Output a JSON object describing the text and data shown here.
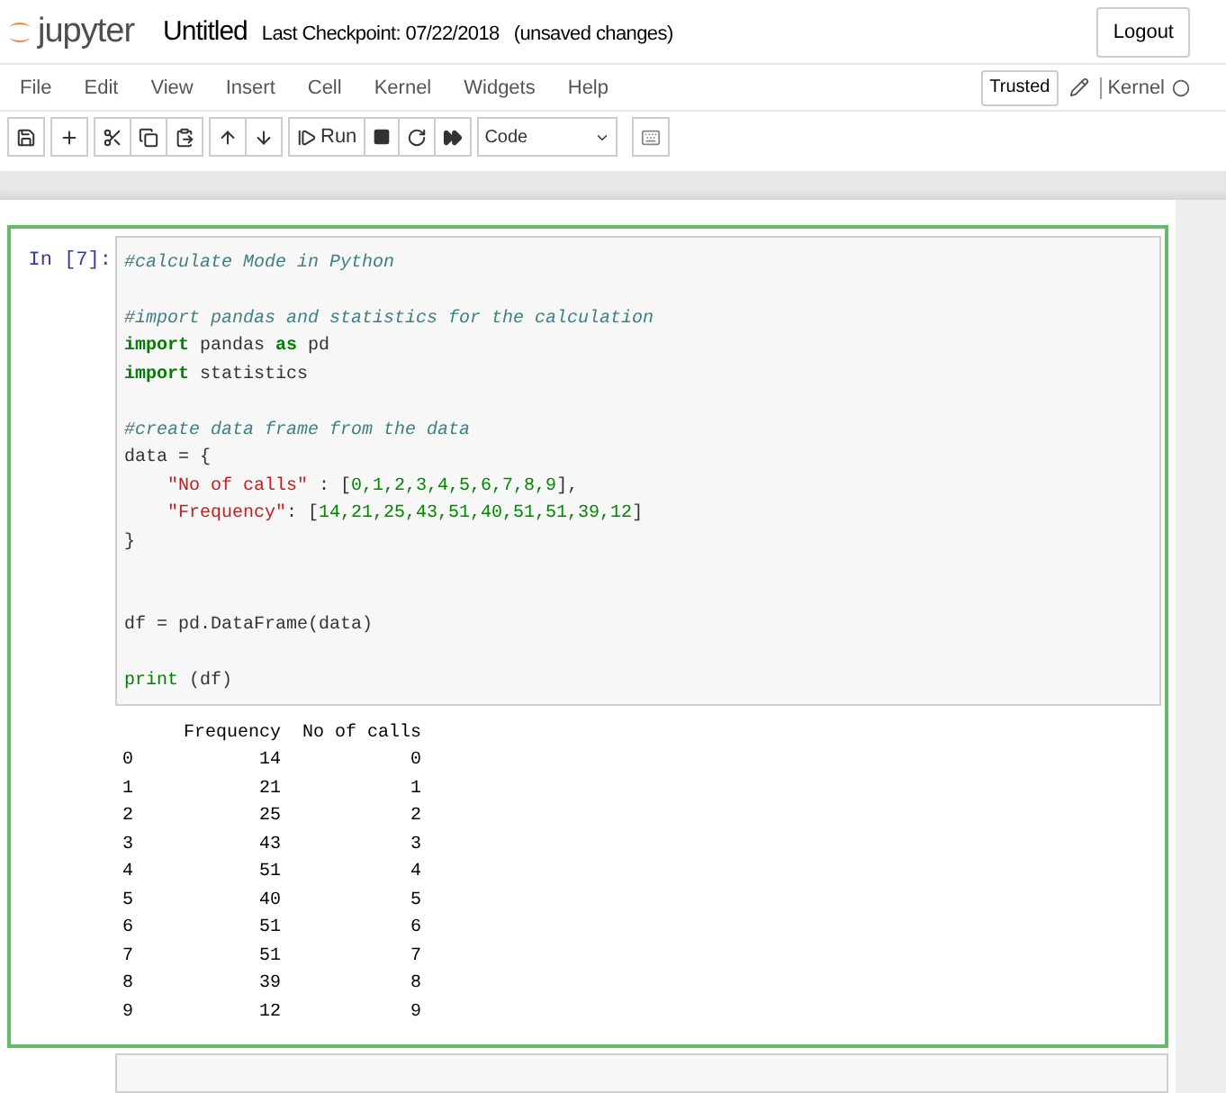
{
  "header": {
    "logo_text": "jupyter",
    "notebook_name": "Untitled",
    "checkpoint": "Last Checkpoint: 07/22/2018",
    "autosave_status": "(unsaved changes)",
    "logout_button": "Logout"
  },
  "menubar": {
    "items": [
      "File",
      "Edit",
      "View",
      "Insert",
      "Cell",
      "Kernel",
      "Widgets",
      "Help"
    ],
    "trusted_button": "Trusted",
    "kernel_label": "Kernel",
    "kernel_busy": false
  },
  "toolbar": {
    "run_label": "Run",
    "cell_type": "Code"
  },
  "cell": {
    "prompt": "In [7]:",
    "selected": true,
    "code_lines": [
      {
        "kind": "code",
        "tokens": [
          {
            "kind": "comment",
            "text": "#calculate Mode in Python"
          }
        ]
      },
      {
        "kind": "blank"
      },
      {
        "kind": "code",
        "tokens": [
          {
            "kind": "comment",
            "text": "#import pandas and statistics for the calculation"
          }
        ]
      },
      {
        "kind": "code",
        "tokens": [
          {
            "kind": "keyword",
            "text": "import"
          },
          {
            "kind": "plain",
            "text": " pandas "
          },
          {
            "kind": "keyword",
            "text": "as"
          },
          {
            "kind": "plain",
            "text": " pd"
          }
        ]
      },
      {
        "kind": "code",
        "tokens": [
          {
            "kind": "keyword",
            "text": "import"
          },
          {
            "kind": "plain",
            "text": " statistics"
          }
        ]
      },
      {
        "kind": "blank"
      },
      {
        "kind": "code",
        "tokens": [
          {
            "kind": "comment",
            "text": "#create data frame from the data"
          }
        ]
      },
      {
        "kind": "code",
        "tokens": [
          {
            "kind": "plain",
            "text": "data = {"
          }
        ]
      },
      {
        "kind": "code",
        "indented": true,
        "tokens": [
          {
            "kind": "string",
            "text": "\"No of calls\""
          },
          {
            "kind": "plain",
            "text": " : ["
          },
          {
            "kind": "number",
            "text": "0,1,2,3,4,5,6,7,8,9"
          },
          {
            "kind": "plain",
            "text": "],"
          }
        ]
      },
      {
        "kind": "code",
        "indented": true,
        "tokens": [
          {
            "kind": "string",
            "text": "\"Frequency\""
          },
          {
            "kind": "plain",
            "text": ": ["
          },
          {
            "kind": "number",
            "text": "14,21,25,43,51,40,51,51,39,12"
          },
          {
            "kind": "plain",
            "text": "]"
          }
        ]
      },
      {
        "kind": "code",
        "tokens": [
          {
            "kind": "plain",
            "text": "}"
          }
        ]
      },
      {
        "kind": "blank"
      },
      {
        "kind": "blank"
      },
      {
        "kind": "code",
        "tokens": [
          {
            "kind": "plain",
            "text": "df = pd.DataFrame(data)"
          }
        ]
      },
      {
        "kind": "blank"
      },
      {
        "kind": "code",
        "tokens": [
          {
            "kind": "builtin",
            "text": "print"
          },
          {
            "kind": "plain",
            "text": " (df)"
          }
        ]
      }
    ],
    "output": {
      "columns": [
        "Frequency",
        "No of calls"
      ],
      "rows": [
        {
          "index": "0",
          "values": [
            "14",
            "0"
          ]
        },
        {
          "index": "1",
          "values": [
            "21",
            "1"
          ]
        },
        {
          "index": "2",
          "values": [
            "25",
            "2"
          ]
        },
        {
          "index": "3",
          "values": [
            "43",
            "3"
          ]
        },
        {
          "index": "4",
          "values": [
            "51",
            "4"
          ]
        },
        {
          "index": "5",
          "values": [
            "40",
            "5"
          ]
        },
        {
          "index": "6",
          "values": [
            "51",
            "6"
          ]
        },
        {
          "index": "7",
          "values": [
            "51",
            "7"
          ]
        },
        {
          "index": "8",
          "values": [
            "39",
            "8"
          ]
        },
        {
          "index": "9",
          "values": [
            "12",
            "9"
          ]
        }
      ]
    }
  }
}
